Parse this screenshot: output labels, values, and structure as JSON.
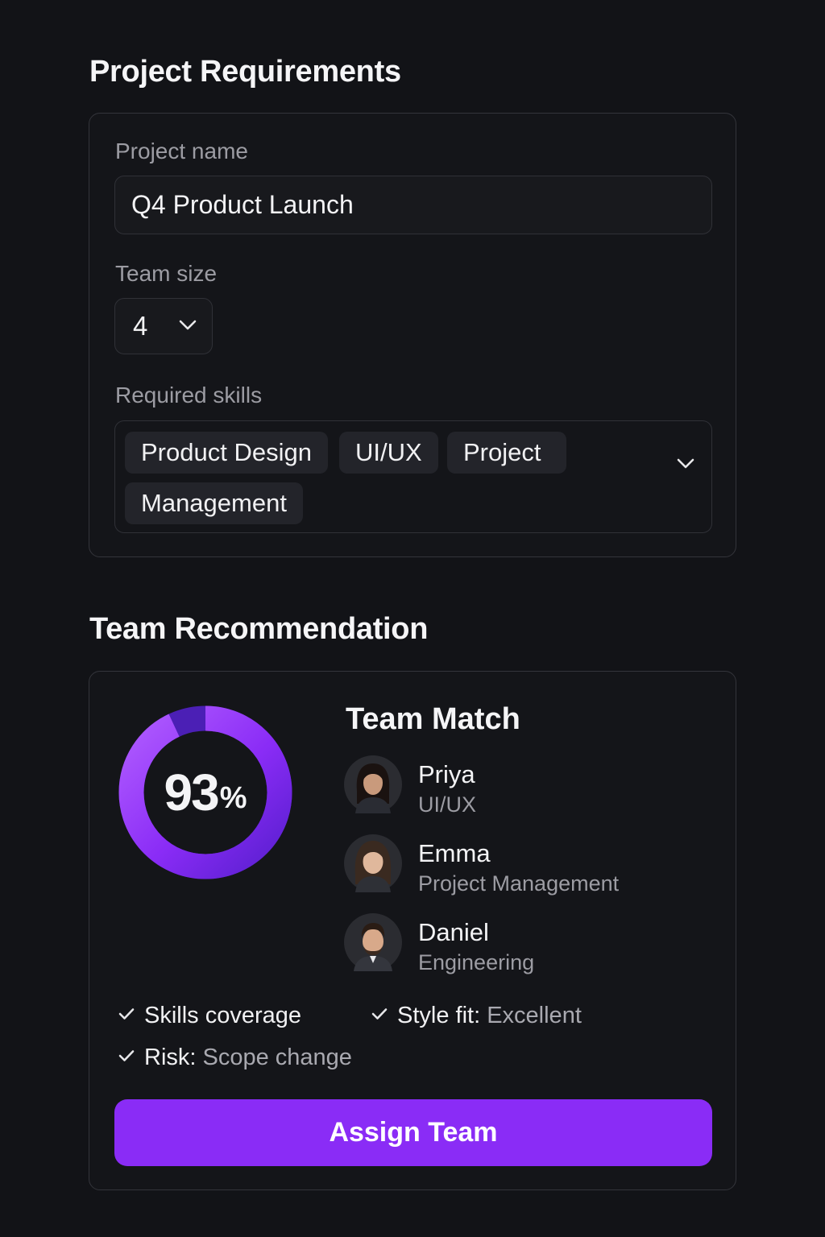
{
  "requirements": {
    "title": "Project Requirements",
    "project_name_label": "Project name",
    "project_name_value": "Q4 Product Launch",
    "team_size_label": "Team size",
    "team_size_value": "4",
    "skills_label": "Required skills",
    "skills": [
      "Product Design",
      "UI/UX",
      "Project",
      "Management"
    ]
  },
  "recommendation": {
    "title": "Team Recommendation",
    "match_percent": 93,
    "match_number": "93",
    "match_unit": "%",
    "match_title": "Team Match",
    "members": [
      {
        "name": "Priya",
        "role": "UI/UX"
      },
      {
        "name": "Emma",
        "role": "Project Management"
      },
      {
        "name": "Daniel",
        "role": "Engineering"
      }
    ],
    "checks": {
      "skills": "Skills coverage",
      "style_label": "Style fit: ",
      "style_value": "Excellent",
      "risk_label": "Risk: ",
      "risk_value": "Scope change"
    },
    "assign_button": "Assign Team"
  },
  "colors": {
    "background": "#121317",
    "accent": "#8a2cf6",
    "ring_light": "#a64dff",
    "ring_dark": "#5a1fd0"
  },
  "icons": {
    "select": "chevron-down-icon",
    "check": "check-icon"
  }
}
